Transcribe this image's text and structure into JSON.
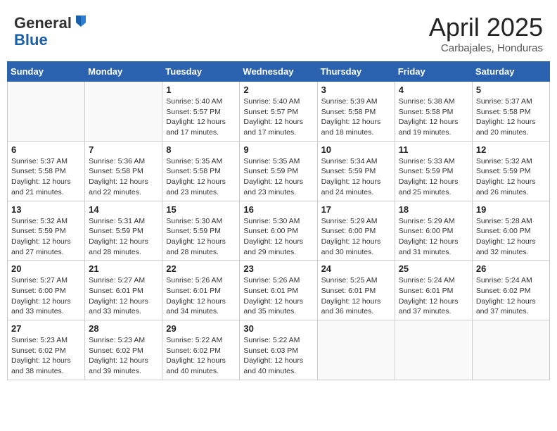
{
  "header": {
    "logo_general": "General",
    "logo_blue": "Blue",
    "title": "April 2025",
    "location": "Carbajales, Honduras"
  },
  "days_of_week": [
    "Sunday",
    "Monday",
    "Tuesday",
    "Wednesday",
    "Thursday",
    "Friday",
    "Saturday"
  ],
  "weeks": [
    [
      {
        "day": "",
        "sunrise": "",
        "sunset": "",
        "daylight": ""
      },
      {
        "day": "",
        "sunrise": "",
        "sunset": "",
        "daylight": ""
      },
      {
        "day": "1",
        "sunrise": "Sunrise: 5:40 AM",
        "sunset": "Sunset: 5:57 PM",
        "daylight": "Daylight: 12 hours and 17 minutes."
      },
      {
        "day": "2",
        "sunrise": "Sunrise: 5:40 AM",
        "sunset": "Sunset: 5:57 PM",
        "daylight": "Daylight: 12 hours and 17 minutes."
      },
      {
        "day": "3",
        "sunrise": "Sunrise: 5:39 AM",
        "sunset": "Sunset: 5:58 PM",
        "daylight": "Daylight: 12 hours and 18 minutes."
      },
      {
        "day": "4",
        "sunrise": "Sunrise: 5:38 AM",
        "sunset": "Sunset: 5:58 PM",
        "daylight": "Daylight: 12 hours and 19 minutes."
      },
      {
        "day": "5",
        "sunrise": "Sunrise: 5:37 AM",
        "sunset": "Sunset: 5:58 PM",
        "daylight": "Daylight: 12 hours and 20 minutes."
      }
    ],
    [
      {
        "day": "6",
        "sunrise": "Sunrise: 5:37 AM",
        "sunset": "Sunset: 5:58 PM",
        "daylight": "Daylight: 12 hours and 21 minutes."
      },
      {
        "day": "7",
        "sunrise": "Sunrise: 5:36 AM",
        "sunset": "Sunset: 5:58 PM",
        "daylight": "Daylight: 12 hours and 22 minutes."
      },
      {
        "day": "8",
        "sunrise": "Sunrise: 5:35 AM",
        "sunset": "Sunset: 5:58 PM",
        "daylight": "Daylight: 12 hours and 23 minutes."
      },
      {
        "day": "9",
        "sunrise": "Sunrise: 5:35 AM",
        "sunset": "Sunset: 5:59 PM",
        "daylight": "Daylight: 12 hours and 23 minutes."
      },
      {
        "day": "10",
        "sunrise": "Sunrise: 5:34 AM",
        "sunset": "Sunset: 5:59 PM",
        "daylight": "Daylight: 12 hours and 24 minutes."
      },
      {
        "day": "11",
        "sunrise": "Sunrise: 5:33 AM",
        "sunset": "Sunset: 5:59 PM",
        "daylight": "Daylight: 12 hours and 25 minutes."
      },
      {
        "day": "12",
        "sunrise": "Sunrise: 5:32 AM",
        "sunset": "Sunset: 5:59 PM",
        "daylight": "Daylight: 12 hours and 26 minutes."
      }
    ],
    [
      {
        "day": "13",
        "sunrise": "Sunrise: 5:32 AM",
        "sunset": "Sunset: 5:59 PM",
        "daylight": "Daylight: 12 hours and 27 minutes."
      },
      {
        "day": "14",
        "sunrise": "Sunrise: 5:31 AM",
        "sunset": "Sunset: 5:59 PM",
        "daylight": "Daylight: 12 hours and 28 minutes."
      },
      {
        "day": "15",
        "sunrise": "Sunrise: 5:30 AM",
        "sunset": "Sunset: 5:59 PM",
        "daylight": "Daylight: 12 hours and 28 minutes."
      },
      {
        "day": "16",
        "sunrise": "Sunrise: 5:30 AM",
        "sunset": "Sunset: 6:00 PM",
        "daylight": "Daylight: 12 hours and 29 minutes."
      },
      {
        "day": "17",
        "sunrise": "Sunrise: 5:29 AM",
        "sunset": "Sunset: 6:00 PM",
        "daylight": "Daylight: 12 hours and 30 minutes."
      },
      {
        "day": "18",
        "sunrise": "Sunrise: 5:29 AM",
        "sunset": "Sunset: 6:00 PM",
        "daylight": "Daylight: 12 hours and 31 minutes."
      },
      {
        "day": "19",
        "sunrise": "Sunrise: 5:28 AM",
        "sunset": "Sunset: 6:00 PM",
        "daylight": "Daylight: 12 hours and 32 minutes."
      }
    ],
    [
      {
        "day": "20",
        "sunrise": "Sunrise: 5:27 AM",
        "sunset": "Sunset: 6:00 PM",
        "daylight": "Daylight: 12 hours and 33 minutes."
      },
      {
        "day": "21",
        "sunrise": "Sunrise: 5:27 AM",
        "sunset": "Sunset: 6:01 PM",
        "daylight": "Daylight: 12 hours and 33 minutes."
      },
      {
        "day": "22",
        "sunrise": "Sunrise: 5:26 AM",
        "sunset": "Sunset: 6:01 PM",
        "daylight": "Daylight: 12 hours and 34 minutes."
      },
      {
        "day": "23",
        "sunrise": "Sunrise: 5:26 AM",
        "sunset": "Sunset: 6:01 PM",
        "daylight": "Daylight: 12 hours and 35 minutes."
      },
      {
        "day": "24",
        "sunrise": "Sunrise: 5:25 AM",
        "sunset": "Sunset: 6:01 PM",
        "daylight": "Daylight: 12 hours and 36 minutes."
      },
      {
        "day": "25",
        "sunrise": "Sunrise: 5:24 AM",
        "sunset": "Sunset: 6:01 PM",
        "daylight": "Daylight: 12 hours and 37 minutes."
      },
      {
        "day": "26",
        "sunrise": "Sunrise: 5:24 AM",
        "sunset": "Sunset: 6:02 PM",
        "daylight": "Daylight: 12 hours and 37 minutes."
      }
    ],
    [
      {
        "day": "27",
        "sunrise": "Sunrise: 5:23 AM",
        "sunset": "Sunset: 6:02 PM",
        "daylight": "Daylight: 12 hours and 38 minutes."
      },
      {
        "day": "28",
        "sunrise": "Sunrise: 5:23 AM",
        "sunset": "Sunset: 6:02 PM",
        "daylight": "Daylight: 12 hours and 39 minutes."
      },
      {
        "day": "29",
        "sunrise": "Sunrise: 5:22 AM",
        "sunset": "Sunset: 6:02 PM",
        "daylight": "Daylight: 12 hours and 40 minutes."
      },
      {
        "day": "30",
        "sunrise": "Sunrise: 5:22 AM",
        "sunset": "Sunset: 6:03 PM",
        "daylight": "Daylight: 12 hours and 40 minutes."
      },
      {
        "day": "",
        "sunrise": "",
        "sunset": "",
        "daylight": ""
      },
      {
        "day": "",
        "sunrise": "",
        "sunset": "",
        "daylight": ""
      },
      {
        "day": "",
        "sunrise": "",
        "sunset": "",
        "daylight": ""
      }
    ]
  ]
}
